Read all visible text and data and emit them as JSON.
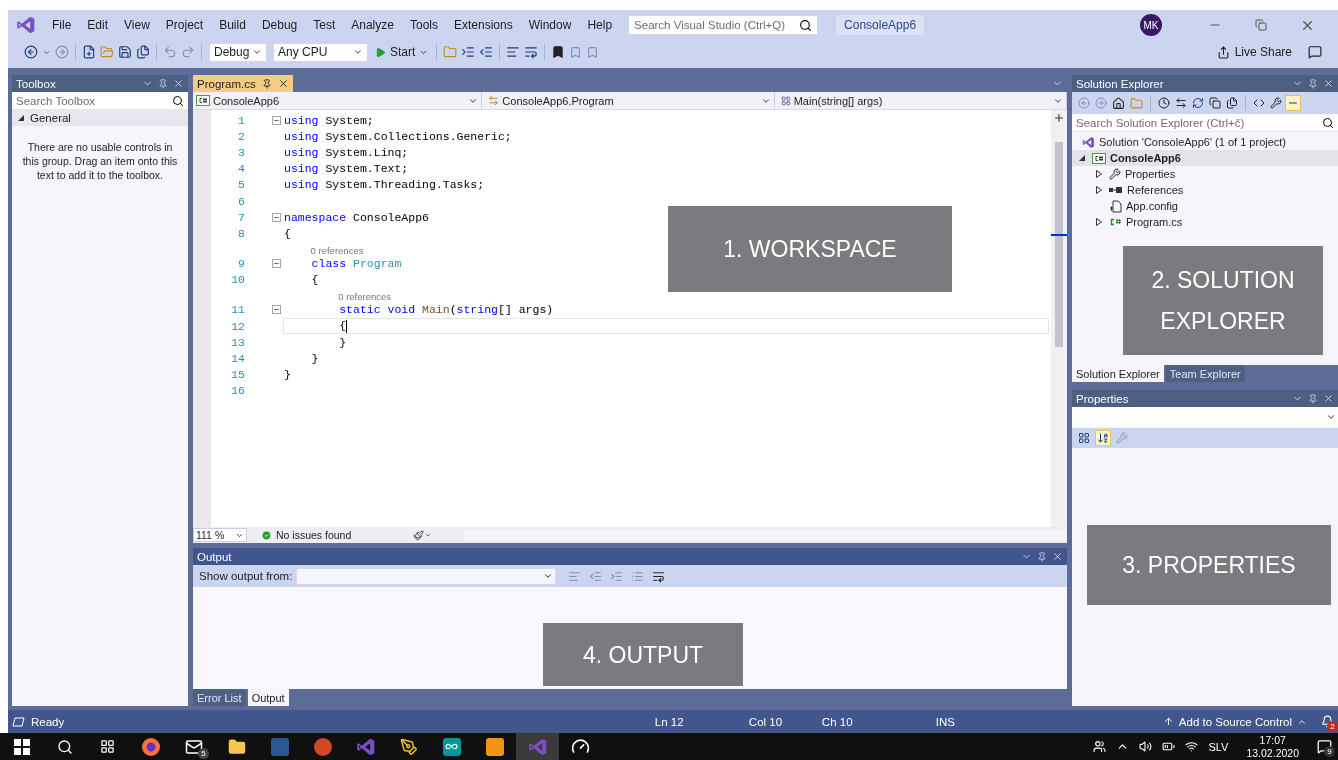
{
  "window": {
    "title": "ConsoleApp6",
    "search": {
      "placeholder": "Search Visual Studio (Ctrl+Q)"
    },
    "avatar": "MK",
    "live_share": "Live Share"
  },
  "menu": [
    "File",
    "Edit",
    "View",
    "Project",
    "Build",
    "Debug",
    "Test",
    "Analyze",
    "Tools",
    "Extensions",
    "Window",
    "Help"
  ],
  "toolbar": {
    "configuration": "Debug",
    "platform": "Any CPU",
    "start": "Start"
  },
  "toolbox": {
    "title": "Toolbox",
    "search": {
      "placeholder": "Search Toolbox"
    },
    "group": {
      "label": "General",
      "expanded": true
    },
    "empty_message": "There are no usable controls in this group. Drag an item onto this text to add it to the toolbox."
  },
  "editor": {
    "tabs": [
      {
        "label": "Program.cs",
        "selected": true
      }
    ],
    "nav": [
      {
        "kind": "project",
        "label": "ConsoleApp6"
      },
      {
        "kind": "class",
        "label": "ConsoleApp6.Program"
      },
      {
        "kind": "method",
        "label": "Main(string[] args)"
      }
    ],
    "lines": [
      {
        "kind": "code",
        "number": "1",
        "fold": true,
        "current": false,
        "segments": [
          {
            "kind": "keyword",
            "text": "using"
          },
          {
            "kind": "plain",
            "text": " System;"
          }
        ]
      },
      {
        "kind": "code",
        "number": "2",
        "fold": false,
        "current": false,
        "segments": [
          {
            "kind": "keyword",
            "text": "using"
          },
          {
            "kind": "plain",
            "text": " System.Collections.Generic;"
          }
        ]
      },
      {
        "kind": "code",
        "number": "3",
        "fold": false,
        "current": false,
        "segments": [
          {
            "kind": "keyword",
            "text": "using"
          },
          {
            "kind": "plain",
            "text": " System.Linq;"
          }
        ]
      },
      {
        "kind": "code",
        "number": "4",
        "fold": false,
        "current": false,
        "segments": [
          {
            "kind": "keyword",
            "text": "using"
          },
          {
            "kind": "plain",
            "text": " System.Text;"
          }
        ]
      },
      {
        "kind": "code",
        "number": "5",
        "fold": false,
        "current": false,
        "segments": [
          {
            "kind": "keyword",
            "text": "using"
          },
          {
            "kind": "plain",
            "text": " System.Threading.Tasks;"
          }
        ]
      },
      {
        "kind": "code",
        "number": "6",
        "fold": false,
        "current": false
      },
      {
        "kind": "code",
        "number": "7",
        "fold": true,
        "current": false,
        "segments": [
          {
            "kind": "keyword",
            "text": "namespace"
          },
          {
            "kind": "plain",
            "text": " ConsoleApp6"
          }
        ]
      },
      {
        "kind": "code",
        "number": "8",
        "fold": false,
        "current": false,
        "segments": [
          {
            "kind": "plain",
            "text": "{"
          }
        ]
      },
      {
        "kind": "codelens",
        "text": "0 references"
      },
      {
        "kind": "code",
        "number": "9",
        "fold": true,
        "current": false,
        "segments": [
          {
            "kind": "keyword",
            "text": "    class"
          },
          {
            "kind": "type",
            "text": " Program"
          }
        ]
      },
      {
        "kind": "code",
        "number": "10",
        "fold": false,
        "current": false,
        "segments": [
          {
            "kind": "plain",
            "text": "    {"
          }
        ]
      },
      {
        "kind": "codelens",
        "text": "0 references"
      },
      {
        "kind": "code",
        "number": "11",
        "fold": true,
        "current": false,
        "segments": [
          {
            "kind": "keyword",
            "text": "        static void"
          },
          {
            "kind": "method",
            "text": " Main"
          },
          {
            "kind": "plain",
            "text": "("
          },
          {
            "kind": "keyword",
            "text": "string"
          },
          {
            "kind": "plain",
            "text": "[] args)"
          }
        ]
      },
      {
        "kind": "code",
        "number": "12",
        "fold": false,
        "current": true,
        "segments": [
          {
            "kind": "plain",
            "text": "        {"
          }
        ]
      },
      {
        "kind": "code",
        "number": "13",
        "fold": false,
        "current": false,
        "segments": [
          {
            "kind": "plain",
            "text": "        }"
          }
        ]
      },
      {
        "kind": "code",
        "number": "14",
        "fold": false,
        "current": false,
        "segments": [
          {
            "kind": "plain",
            "text": "    }"
          }
        ]
      },
      {
        "kind": "code",
        "number": "15",
        "fold": false,
        "current": false,
        "segments": [
          {
            "kind": "plain",
            "text": "}"
          }
        ]
      },
      {
        "kind": "code",
        "number": "16",
        "fold": false,
        "current": false
      }
    ],
    "zoom": "111 %",
    "issues": "No issues found",
    "annotation": "1. WORKSPACE"
  },
  "solution_explorer": {
    "title": "Solution Explorer",
    "search": {
      "placeholder": "Search Solution Explorer (Ctrl+č)"
    },
    "tree": [
      {
        "kind": "solution",
        "label": "Solution 'ConsoleApp6' (1 of 1 project)",
        "expandable": false,
        "selected": false,
        "children": [
          {
            "kind": "project",
            "label": "ConsoleApp6",
            "expandable": true,
            "expanded": true,
            "selected": true,
            "children": [
              {
                "kind": "properties",
                "label": "Properties",
                "expandable": true,
                "expanded": false,
                "selected": false
              },
              {
                "kind": "references",
                "label": "References",
                "expandable": true,
                "expanded": false,
                "selected": false
              },
              {
                "kind": "config",
                "label": "App.config",
                "expandable": false,
                "selected": false
              },
              {
                "kind": "csharp",
                "label": "Program.cs",
                "expandable": true,
                "expanded": false,
                "selected": false
              }
            ]
          }
        ]
      }
    ],
    "tabs": [
      {
        "label": "Solution Explorer",
        "selected": true
      },
      {
        "label": "Team Explorer",
        "selected": false
      }
    ],
    "annotation": "2. SOLUTION EXPLORER"
  },
  "properties": {
    "title": "Properties",
    "tools": [
      {
        "kind": "categorized",
        "selected": false,
        "disabled": false
      },
      {
        "kind": "alphabetical",
        "selected": true,
        "disabled": false
      },
      {
        "kind": "pages",
        "selected": false,
        "disabled": true
      }
    ],
    "annotation": "3. PROPERTIES"
  },
  "output": {
    "title": "Output",
    "show_from_label": "Show output from:",
    "tabs": [
      {
        "label": "Error List",
        "selected": false
      },
      {
        "label": "Output",
        "selected": true
      }
    ],
    "annotation": "4. OUTPUT"
  },
  "status_bar": {
    "message": "Ready",
    "line": "Ln 12",
    "column": "Col 10",
    "char": "Ch 10",
    "mode": "INS",
    "source_control": "Add to Source Control",
    "notifications": "2"
  },
  "taskbar": {
    "apps": [
      {
        "kind": "browser",
        "active": false
      },
      {
        "kind": "mail",
        "active": false,
        "badge": "5"
      },
      {
        "kind": "folder",
        "active": false
      },
      {
        "kind": "document",
        "active": false
      },
      {
        "kind": "presentation",
        "active": false
      },
      {
        "kind": "ide",
        "active": false
      },
      {
        "kind": "tools",
        "active": false
      },
      {
        "kind": "infinity",
        "active": false
      },
      {
        "kind": "editor",
        "active": false
      },
      {
        "kind": "ide",
        "active": true
      },
      {
        "kind": "gauge",
        "active": false
      }
    ],
    "language": "SLV",
    "time": "17:07",
    "date": "13.02.2020",
    "notifications": "9"
  }
}
